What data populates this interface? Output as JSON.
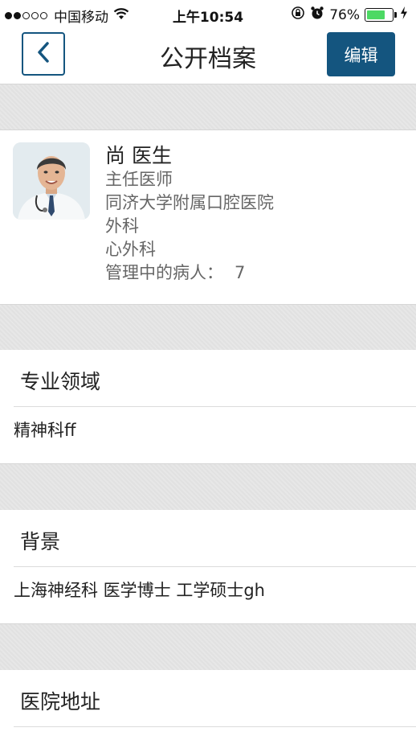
{
  "status_bar": {
    "carrier": "中国移动",
    "time": "上午10:54",
    "battery_percent": "76%",
    "battery_level": 0.76,
    "signal_bars_filled": 2,
    "signal_bars_total": 5
  },
  "nav": {
    "title": "公开档案",
    "edit_label": "编辑",
    "accent_color": "#14557f"
  },
  "profile": {
    "name": "尚 医生",
    "title": "主任医师",
    "hospital": "同济大学附属口腔医院",
    "department": "外科",
    "subdepartment": "心外科",
    "patients_label": "管理中的病人：",
    "patients_count": "7"
  },
  "sections": [
    {
      "title": "专业领域",
      "body": "精神科ff"
    },
    {
      "title": "背景",
      "body": "上海神经科 医学博士 工学硕士gh"
    },
    {
      "title": "医院地址",
      "body": ""
    }
  ]
}
